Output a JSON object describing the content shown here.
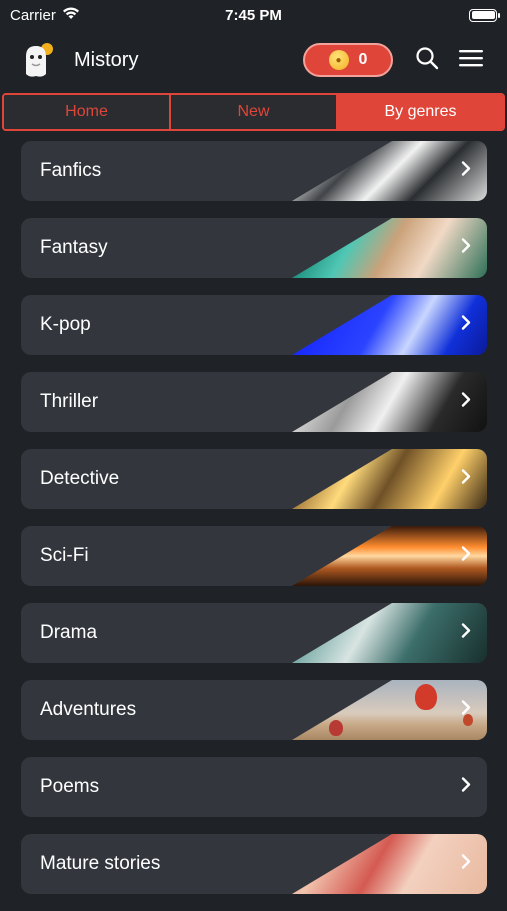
{
  "status_bar": {
    "carrier": "Carrier",
    "time": "7:45 PM"
  },
  "header": {
    "app_title": "Mistory",
    "coin_count": "0",
    "icons": [
      "mascot-logo-icon",
      "coin-icon",
      "search-icon",
      "menu-icon"
    ]
  },
  "tabs": [
    {
      "label": "Home",
      "active": false
    },
    {
      "label": "New",
      "active": false
    },
    {
      "label": "By genres",
      "active": true
    }
  ],
  "genres": [
    {
      "label": "Fanfics"
    },
    {
      "label": "Fantasy"
    },
    {
      "label": "K-pop"
    },
    {
      "label": "Thriller"
    },
    {
      "label": "Detective"
    },
    {
      "label": "Sci-Fi"
    },
    {
      "label": "Drama"
    },
    {
      "label": "Adventures"
    },
    {
      "label": "Poems"
    },
    {
      "label": "Mature stories"
    }
  ],
  "colors": {
    "accent": "#e0453a",
    "background": "#1f2226",
    "card": "#33373d",
    "text": "#ffffff"
  }
}
